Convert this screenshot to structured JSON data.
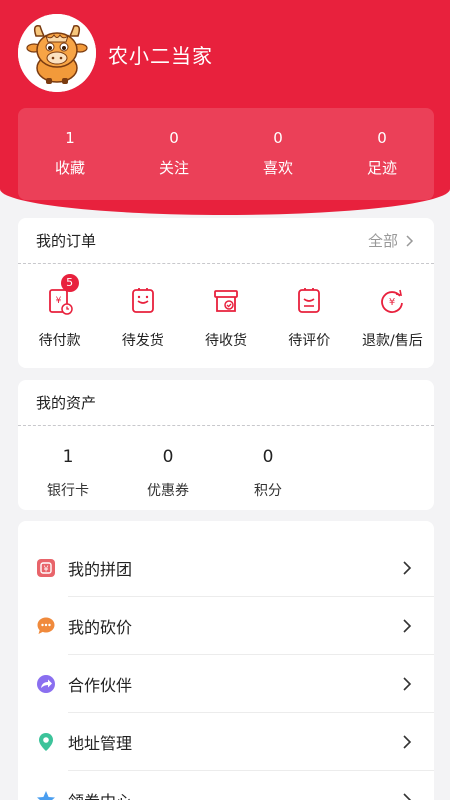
{
  "profile": {
    "username": "农小二当家",
    "avatar_icon": "cow-mascot-icon"
  },
  "stats": [
    {
      "count": "1",
      "label": "收藏"
    },
    {
      "count": "0",
      "label": "关注"
    },
    {
      "count": "0",
      "label": "喜欢"
    },
    {
      "count": "0",
      "label": "足迹"
    }
  ],
  "orders": {
    "title": "我的订单",
    "all_label": "全部",
    "items": [
      {
        "label": "待付款",
        "icon": "pending-payment-icon",
        "badge": "5"
      },
      {
        "label": "待发货",
        "icon": "pending-shipment-icon"
      },
      {
        "label": "待收货",
        "icon": "pending-receipt-icon"
      },
      {
        "label": "待评价",
        "icon": "pending-review-icon"
      },
      {
        "label": "退款/售后",
        "icon": "refund-icon"
      }
    ]
  },
  "assets": {
    "title": "我的资产",
    "items": [
      {
        "value": "1",
        "label": "银行卡"
      },
      {
        "value": "0",
        "label": "优惠券"
      },
      {
        "value": "0",
        "label": "积分"
      }
    ]
  },
  "menu": [
    {
      "label": "我的拼团",
      "icon": "group-buy-icon",
      "color": "#e8646a"
    },
    {
      "label": "我的砍价",
      "icon": "bargain-chat-icon",
      "color": "#f08a3c"
    },
    {
      "label": "合作伙伴",
      "icon": "partner-share-icon",
      "color": "#8a6ff0"
    },
    {
      "label": "地址管理",
      "icon": "location-pin-icon",
      "color": "#3cc39a"
    },
    {
      "label": "领券中心",
      "icon": "coupon-star-icon",
      "color": "#4a9ef0"
    }
  ],
  "colors": {
    "brand": "#e8213d",
    "background": "#f3f3f5"
  }
}
